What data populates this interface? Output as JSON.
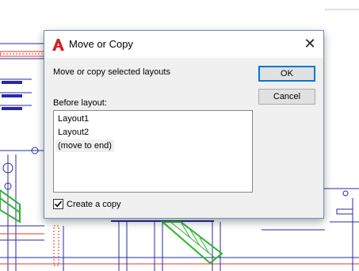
{
  "dialog": {
    "title": "Move or Copy",
    "close_glyph": "✕",
    "instruction": "Move or copy selected layouts",
    "before_layout_label": "Before layout:",
    "ok_label": "OK",
    "cancel_label": "Cancel",
    "layouts": [
      "Layout1",
      "Layout2",
      "(move to end)"
    ],
    "selected_layout": "(move to end)",
    "create_copy_label": "Create a copy",
    "create_copy_checked": true
  },
  "colors": {
    "app_icon": "#d4202a",
    "focus_border": "#0078d7",
    "drawing_green": "#2fb52f",
    "drawing_blue": "#2a2aa8",
    "drawing_red": "#e03a2a"
  },
  "icons": {
    "app": "autocad-a-icon",
    "close": "close-icon",
    "check": "checkmark-icon"
  }
}
